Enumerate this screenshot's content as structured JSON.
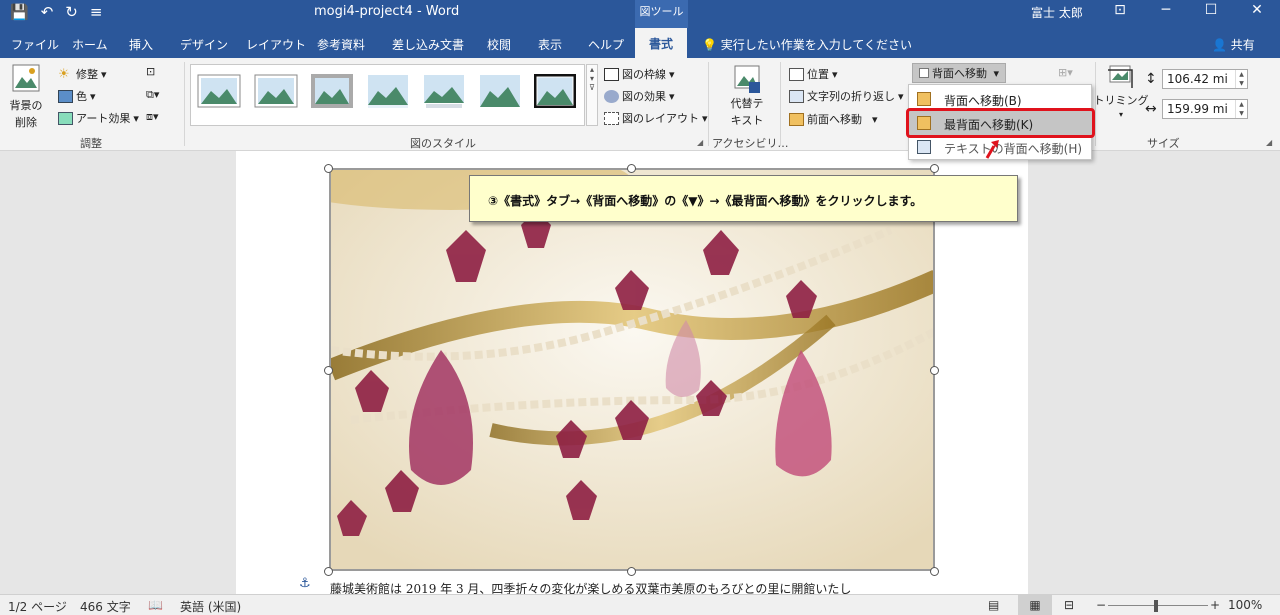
{
  "app": {
    "title": "mogi4-project4  -  Word",
    "context_tab_group": "図ツール",
    "user": "富士 太郎",
    "qat": {
      "save": "💾",
      "undo": "↶",
      "redo": "↻",
      "more": "≡"
    },
    "window": {
      "ribbon_opts": "⊡",
      "minimize": "─",
      "maximize": "☐",
      "close": "✕"
    }
  },
  "tabs": [
    "ファイル",
    "ホーム",
    "挿入",
    "デザイン",
    "レイアウト",
    "参考資料",
    "差し込み文書",
    "校閲",
    "表示",
    "ヘルプ",
    "書式"
  ],
  "active_tab": "書式",
  "tellme": "実行したい作業を入力してください",
  "share": "共有",
  "ribbon": {
    "adjust": {
      "remove_bg_line1": "背景の",
      "remove_bg_line2": "削除",
      "corrections": "修整",
      "color": "色",
      "artistic": "アート効果",
      "label": "調整"
    },
    "styles": {
      "border": "図の枠線",
      "effects": "図の効果",
      "layout": "図のレイアウト",
      "label": "図のスタイル"
    },
    "access": {
      "alt_line1": "代替テ",
      "alt_line2": "キスト",
      "label": "アクセシビリ…"
    },
    "arrange": {
      "position": "位置",
      "wrap": "文字列の折り返し",
      "bring_forward": "前面へ移動",
      "send_backward": "背面へ移動"
    },
    "size": {
      "crop": "トリミング",
      "height": "106.42 mi",
      "width": "159.99 mi",
      "label": "サイズ"
    }
  },
  "dropdown": {
    "items": [
      "背面へ移動(B)",
      "最背面へ移動(K)",
      "テキストの背面へ移動(H)"
    ],
    "highlighted_index": 1
  },
  "callout": "③《書式》タブ→《背面へ移動》の《▼》→《最背面へ移動》をクリックします。",
  "document": {
    "body_text": "藤城美術館は 2019 年 3 月、四季折々の変化が楽しめる双葉市美原のもろびとの里に開館いたし",
    "anchor": "⚓"
  },
  "status": {
    "page": "1/2 ページ",
    "words": "466 文字",
    "lang": "英語 (米国)",
    "zoom": "100%"
  },
  "colors": {
    "brand": "#2b579a",
    "highlight_border": "#e0121c",
    "callout_bg": "#ffffcc"
  }
}
